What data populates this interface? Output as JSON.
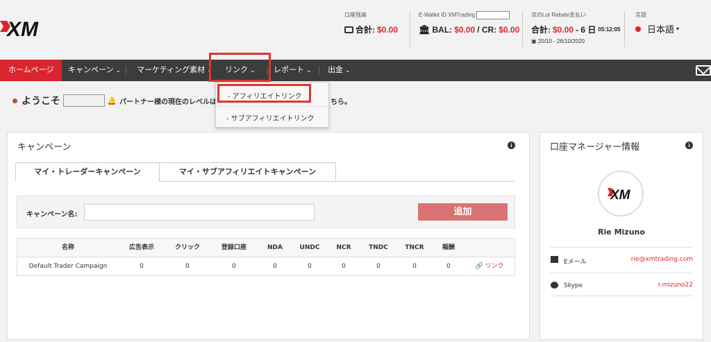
{
  "header": {
    "balance": {
      "label": "口座残高",
      "prefix": "合計:",
      "value": "$0.00"
    },
    "ewallet": {
      "label": "E-Wallet ID XMTrading",
      "bal_label": "BAL:",
      "bal_value": "$0.00",
      "cr_label": "/ CR:",
      "cr_value": "$0.00"
    },
    "rebate": {
      "label": "次のLot Rebate支払い",
      "prefix": "合計:",
      "value": "$0.00",
      "days": "- 6 日",
      "time": "05:12:05",
      "range": "20/10 - 26/10/2020"
    },
    "language": {
      "label": "言語",
      "value": "日本語"
    }
  },
  "nav": {
    "home": "ホームページ",
    "campaign": "キャンペーン",
    "marketing": "マーケティング素材",
    "link": "リンク",
    "report": "レポート",
    "withdraw": "出金"
  },
  "dropdown": {
    "affiliate": "- アフィリエイトリンク",
    "subaffiliate": "- サブアフィリエイトリンク"
  },
  "welcome": {
    "greeting": "ようこそ",
    "level_text": "パートナー様の現在のレベルは",
    "level_tail": "ちら。"
  },
  "campaign_panel": {
    "title": "キャンペーン",
    "tabs": [
      "マイ・トレーダーキャンペーン",
      "マイ・サブアフィリエイトキャンペーン"
    ],
    "search_label": "キャンペーン名:",
    "add_label": "追加",
    "columns": [
      "名称",
      "広告表示",
      "クリック",
      "登録口座",
      "NDA",
      "UNDC",
      "NCR",
      "TNDC",
      "TNCR",
      "報酬",
      ""
    ],
    "rows": [
      [
        "Default Trader Campaign",
        "0",
        "0",
        "0",
        "0",
        "0",
        "0",
        "0",
        "0",
        "0",
        "リンク"
      ]
    ]
  },
  "manager_panel": {
    "title": "口座マネージャー情報",
    "name": "Rie Mizuno",
    "email_label": "Eメール",
    "email": "rie@xmtrading.com",
    "skype_label": "Skype",
    "skype": "r.mizuno22"
  },
  "colors": {
    "brand_red": "#d9262e",
    "nav_bg": "#3c3c3c",
    "highlight": "#e0332f"
  }
}
